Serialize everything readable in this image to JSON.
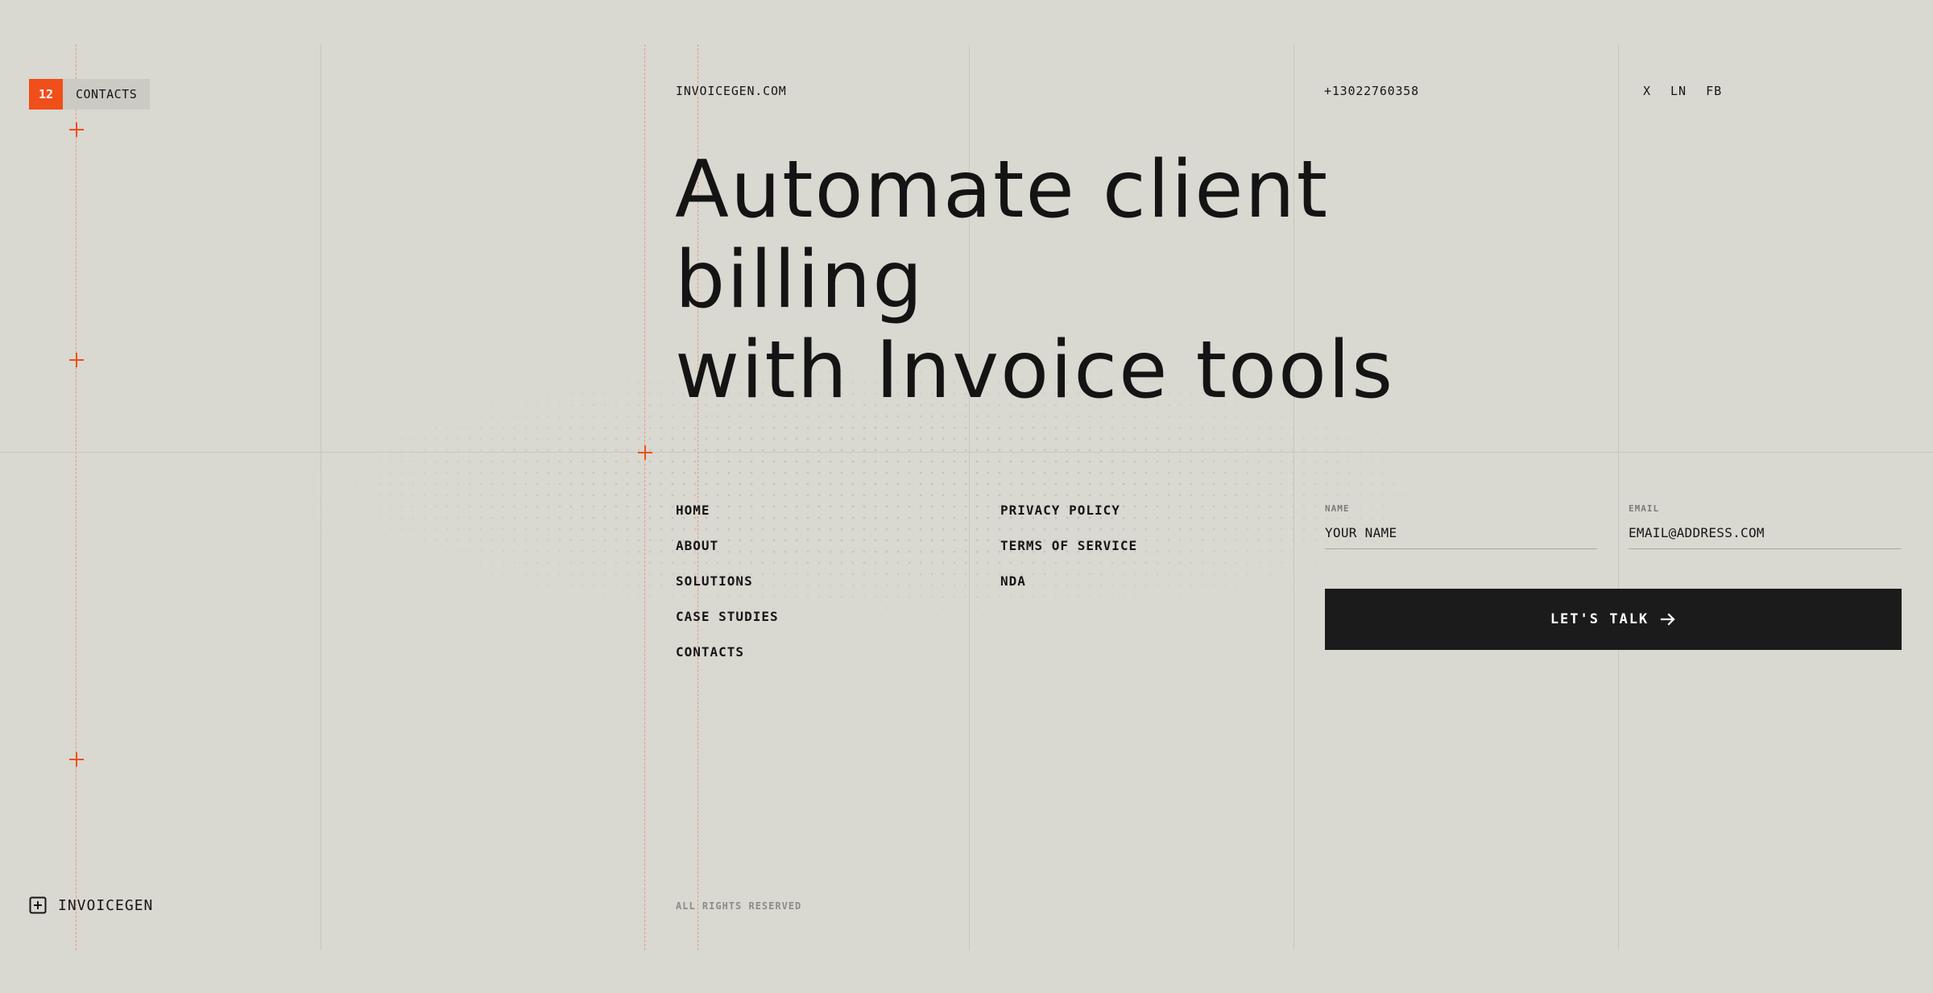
{
  "colors": {
    "background": "#d9d8d1",
    "accent": "#f04e1a",
    "text": "#161616",
    "button": "#1b1b1b"
  },
  "badge": {
    "count": "12",
    "label": "CONTACTS"
  },
  "header": {
    "site": "INVOICEGEN.COM",
    "phone": "+13022760358",
    "socials": [
      "X",
      "LN",
      "FB"
    ]
  },
  "hero": {
    "line1": "Automate client",
    "line2": "billing",
    "line3": "with Invoice tools"
  },
  "nav_primary": [
    "HOME",
    "ABOUT",
    "SOLUTIONS",
    "CASE STUDIES",
    "CONTACTS"
  ],
  "nav_legal": [
    "PRIVACY POLICY",
    "TERMS OF SERVICE",
    "NDA"
  ],
  "form": {
    "name_label": "NAME",
    "name_placeholder": "YOUR NAME",
    "email_label": "EMAIL",
    "email_placeholder": "EMAIL@ADDRESS.COM",
    "submit_label": "LET'S TALK",
    "submit_icon": "arrow-right-icon"
  },
  "footer": {
    "brand": "INVOICEGEN",
    "brand_icon": "plus-square-icon",
    "rights": "ALL RIGHTS RESERVED"
  }
}
